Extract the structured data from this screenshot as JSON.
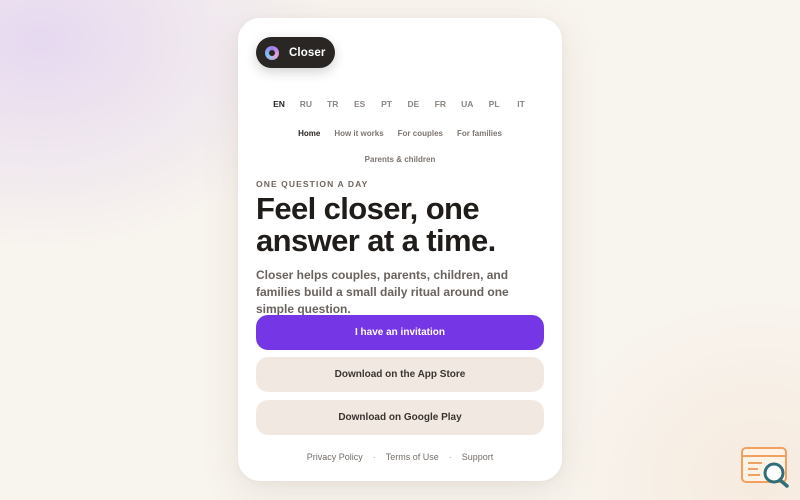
{
  "brand": {
    "name": "Closer"
  },
  "languages": {
    "items": [
      "EN",
      "RU",
      "TR",
      "ES",
      "PT",
      "DE",
      "FR",
      "UA",
      "PL",
      "IT"
    ],
    "selected": "EN"
  },
  "nav": {
    "items": [
      "Home",
      "How it works",
      "For couples",
      "For families",
      "Parents & children"
    ],
    "selected": "Home"
  },
  "hero": {
    "eyebrow": "ONE QUESTION A DAY",
    "headline": "Feel closer, one answer at a time.",
    "subtitle": "Closer helps couples, parents, children, and families build a small daily ritual around one simple question."
  },
  "actions": {
    "invitation": "I have an invitation",
    "app_store": "Download on the App Store",
    "google_play": "Download on Google Play"
  },
  "footer": {
    "privacy": "Privacy Policy",
    "terms": "Terms of Use",
    "support": "Support",
    "separator": "·"
  },
  "colors": {
    "accent": "#7536e6",
    "secondary_button": "#f1e9e1",
    "brand_pill": "#2a2623"
  },
  "icons": {
    "brand_logo": "closer-logo-icon",
    "corner": "search-window-icon"
  }
}
